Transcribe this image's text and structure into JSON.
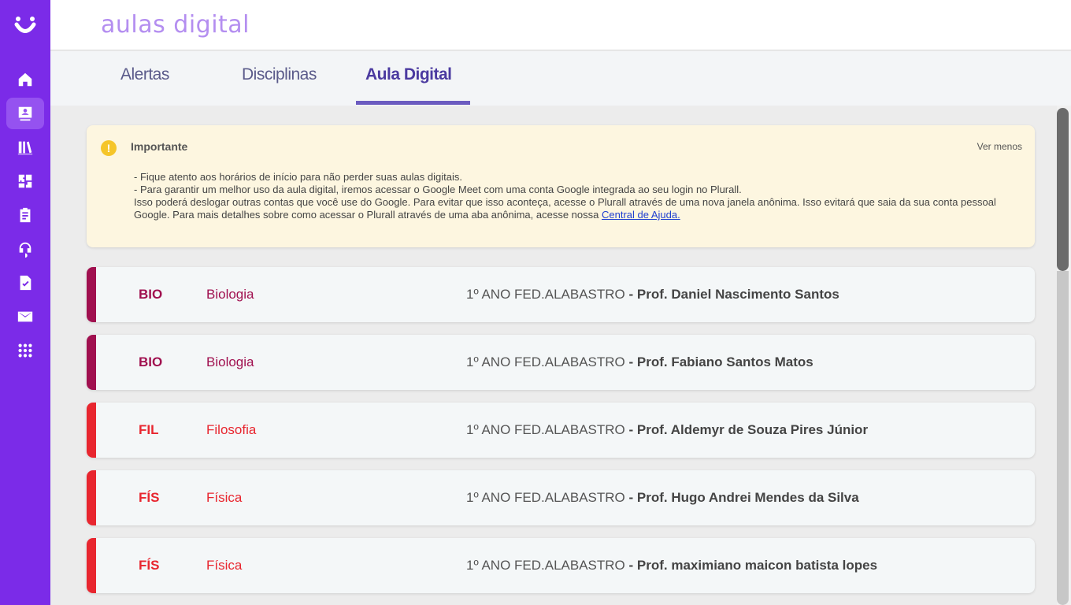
{
  "app": {
    "brand": "aulas digital"
  },
  "sidebar": {
    "items": [
      {
        "icon": "home-icon",
        "active": false
      },
      {
        "icon": "student-card-icon",
        "active": true
      },
      {
        "icon": "books-icon",
        "active": false
      },
      {
        "icon": "puzzle-icon",
        "active": false
      },
      {
        "icon": "clipboard-icon",
        "active": false
      },
      {
        "icon": "support-icon",
        "active": false
      },
      {
        "icon": "document-check-icon",
        "active": false
      },
      {
        "icon": "mail-icon",
        "active": false
      },
      {
        "icon": "apps-grid-icon",
        "active": false
      }
    ]
  },
  "tabs": [
    {
      "label": "Alertas"
    },
    {
      "label": "Disciplinas"
    },
    {
      "label": "Aula Digital"
    }
  ],
  "notice": {
    "title": "Importante",
    "toggle": "Ver menos",
    "line1": "- Fique atento aos horários de início para não perder suas aulas digitais.",
    "line2": "- Para garantir um melhor uso da aula digital, iremos acessar o Google Meet com uma conta Google integrada ao seu login no Plurall.",
    "line3": "Isso poderá deslogar outras contas que você use do Google. Para evitar que isso aconteça, acesse o Plurall através de uma nova janela anônima. Isso evitará que saia da sua conta pessoal Google. Para mais detalhes sobre como acessar o Plurall através de uma aba anônima, acesse nossa ",
    "link": "Central de Ajuda."
  },
  "classes": [
    {
      "code": "BIO",
      "subject": "Biologia",
      "group": "1º ANO FED.ALABASTRO",
      "sep": " - ",
      "teacher": "Prof. Daniel Nascimento Santos",
      "color": "#a0104f"
    },
    {
      "code": "BIO",
      "subject": "Biologia",
      "group": "1º ANO FED.ALABASTRO",
      "sep": " - ",
      "teacher": "Prof. Fabiano Santos Matos",
      "color": "#a0104f"
    },
    {
      "code": "FIL",
      "subject": "Filosofia",
      "group": "1º ANO FED.ALABASTRO",
      "sep": " - ",
      "teacher": "Prof. Aldemyr de Souza Pires Júnior",
      "color": "#e8262f"
    },
    {
      "code": "FÍS",
      "subject": "Física",
      "group": "1º ANO FED.ALABASTRO",
      "sep": " - ",
      "teacher": "Prof. Hugo Andrei Mendes da Silva",
      "color": "#e8262f"
    },
    {
      "code": "FÍS",
      "subject": "Física",
      "group": "1º ANO FED.ALABASTRO",
      "sep": " - ",
      "teacher": "Prof. maximiano maicon batista lopes",
      "color": "#e8262f"
    }
  ]
}
